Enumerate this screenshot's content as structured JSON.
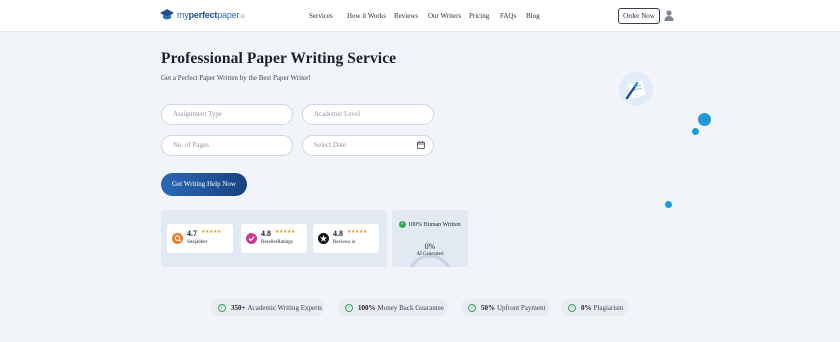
{
  "header": {
    "logo": {
      "part1": "my",
      "part2": "perfect",
      "part3": "paper",
      "part4": ".io"
    },
    "nav": [
      {
        "label": "Services"
      },
      {
        "label": "How it Works"
      },
      {
        "label": "Reviews"
      },
      {
        "label": "Our Writers"
      },
      {
        "label": "Pricing"
      },
      {
        "label": "FAQs"
      },
      {
        "label": "Blog"
      }
    ],
    "order_label": "Order Now"
  },
  "hero": {
    "title": "Professional Paper Writing Service",
    "subtitle": "Get a Perfect Paper Written by the Best Paper Writer!"
  },
  "form": {
    "assignment_type": "Assignment Type",
    "academic_level": "Academic Level",
    "pages": "No. of Pages",
    "date": "Select Date",
    "cta": "Get Writing Help Now"
  },
  "ratings": [
    {
      "score": "4.7",
      "stars": "★★★★★",
      "site": "Sitejabber",
      "icon": "sitejabber-icon"
    },
    {
      "score": "4.8",
      "stars": "★★★★★",
      "site": "ResellerRatings",
      "icon": "resellerratings-icon"
    },
    {
      "score": "4.8",
      "stars": "★★★★★",
      "site": "Reviews.io",
      "icon": "reviewsio-icon"
    }
  ],
  "human": {
    "label": "100% Human Written",
    "ai_value": "0%",
    "ai_label": "AI Generated",
    "ai_fraction": 0
  },
  "features": [
    {
      "num": "350+",
      "text": "Academic Writing Experts"
    },
    {
      "num": "100%",
      "text": "Money Back Guarantee"
    },
    {
      "num": "50%",
      "text": "Upfront Payment"
    },
    {
      "num": "0%",
      "text": "Plagiarism"
    }
  ],
  "colors": {
    "primary": "#1d4f91",
    "accent": "#1e9ad8",
    "background": "#f1f4f9",
    "check": "#35a853",
    "star": "#e4a11b"
  }
}
